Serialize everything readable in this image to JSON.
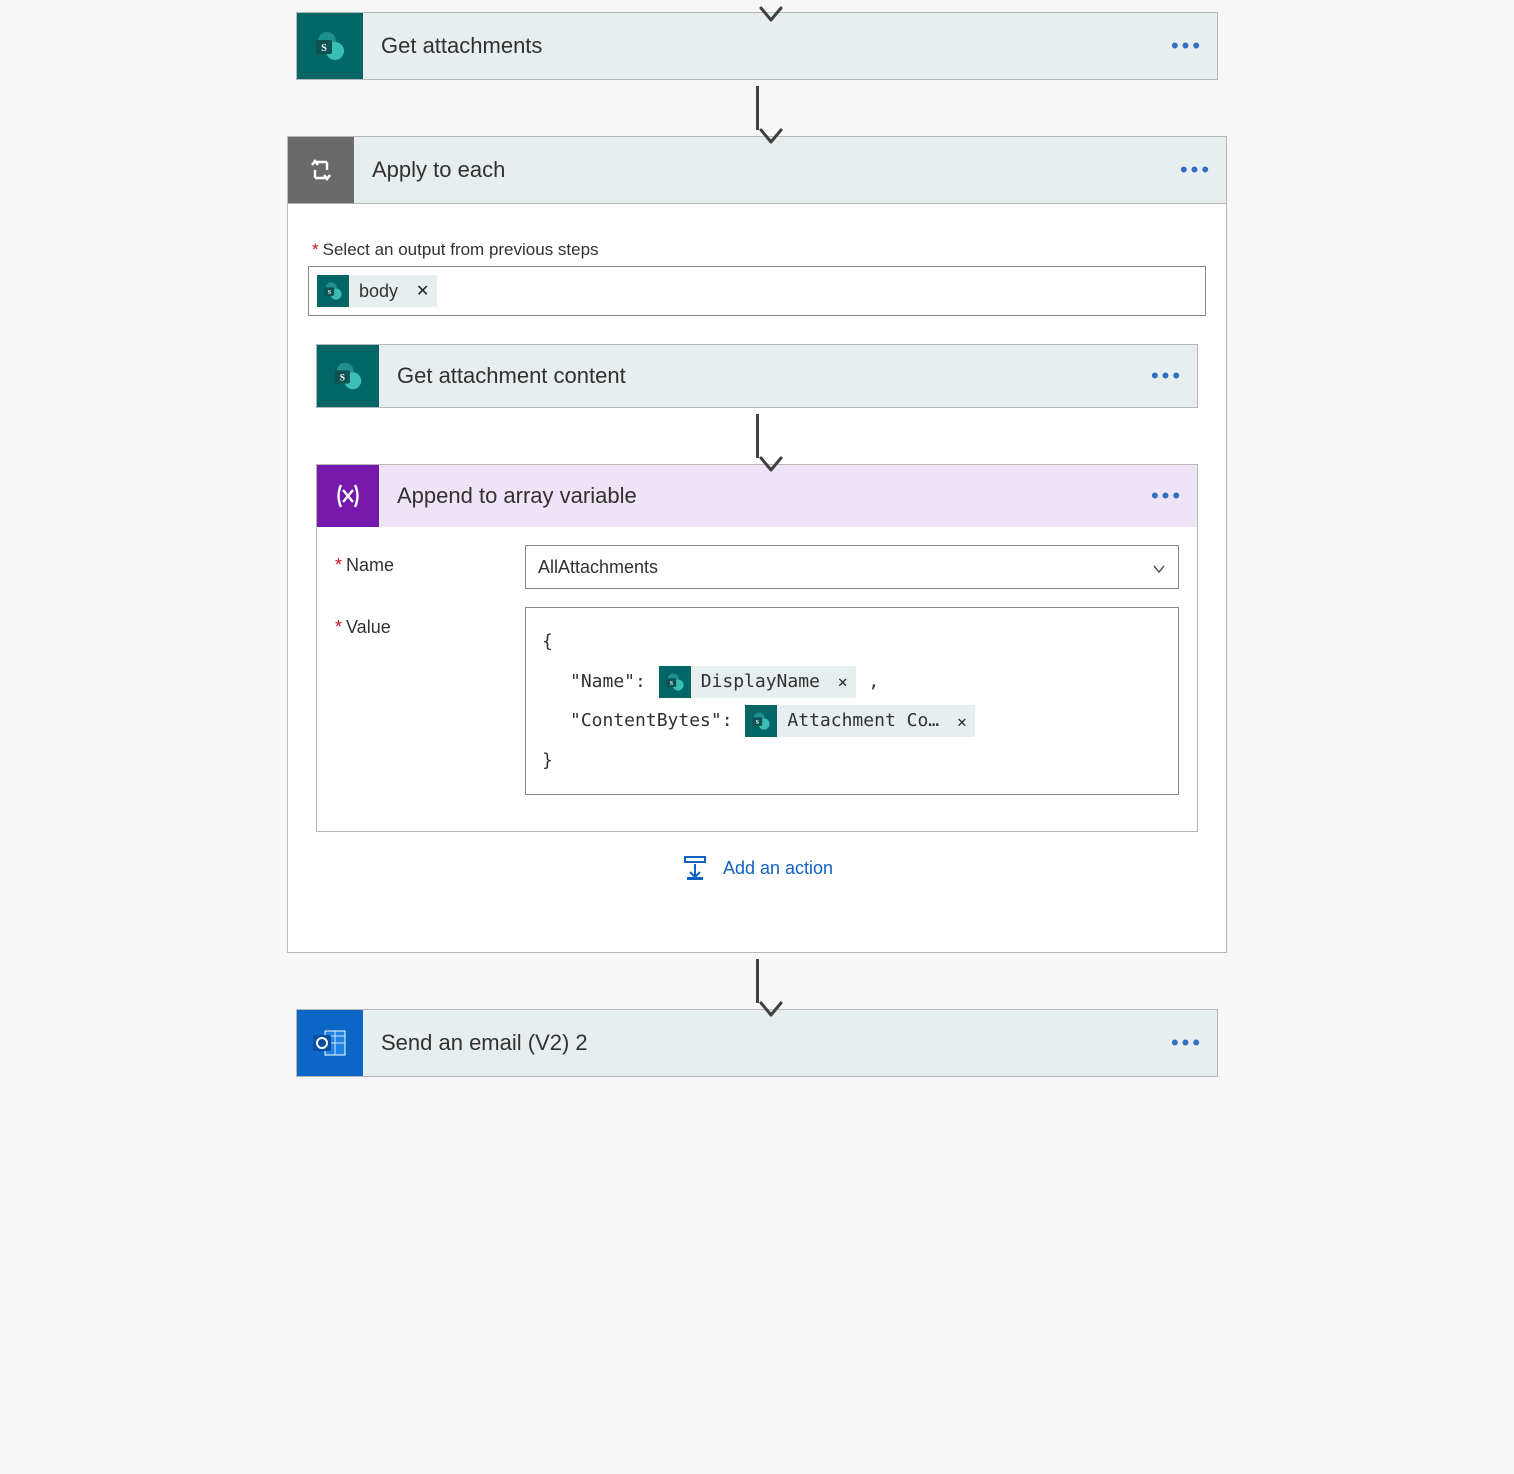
{
  "actions": {
    "get_attachments": {
      "title": "Get attachments"
    },
    "apply_to_each": {
      "title": "Apply to each",
      "select_label": "Select an output from previous steps",
      "token_label": "body",
      "add_action": "Add an action"
    },
    "get_attachment_content": {
      "title": "Get attachment content"
    },
    "append_array": {
      "title": "Append to array variable",
      "name_label": "Name",
      "name_value": "AllAttachments",
      "value_label": "Value",
      "code": {
        "open": "{",
        "kname": "\"Name\":",
        "token_name": "DisplayName",
        "comma": ",",
        "kcontent": "\"ContentBytes\":",
        "token_content": "Attachment Co…",
        "close": "}"
      }
    },
    "send_email": {
      "title": "Send an email (V2) 2"
    }
  },
  "glyph": {
    "x": "✕"
  }
}
